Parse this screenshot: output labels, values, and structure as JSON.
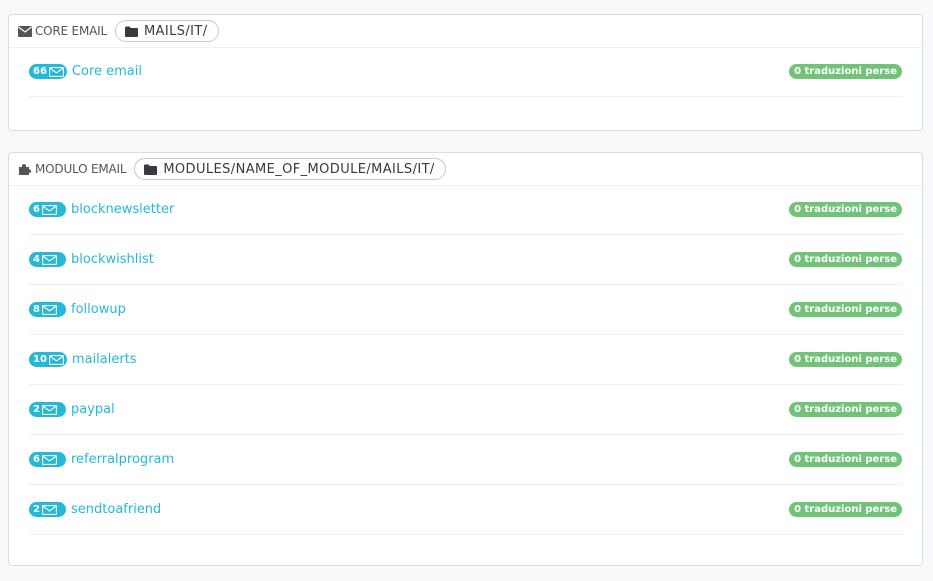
{
  "core_section": {
    "title": "CORE EMAIL",
    "path": "MAILS/IT/",
    "rows": [
      {
        "count": "66",
        "label": "Core email",
        "status": "0 traduzioni perse"
      }
    ]
  },
  "module_section": {
    "title": "MODULO EMAIL",
    "path": "MODULES/NAME_OF_MODULE/MAILS/IT/",
    "rows": [
      {
        "count": "6",
        "label": "blocknewsletter",
        "status": "0 traduzioni perse"
      },
      {
        "count": "4",
        "label": "blockwishlist",
        "status": "0 traduzioni perse"
      },
      {
        "count": "8",
        "label": "followup",
        "status": "0 traduzioni perse"
      },
      {
        "count": "10",
        "label": "mailalerts",
        "status": "0 traduzioni perse"
      },
      {
        "count": "2",
        "label": "paypal",
        "status": "0 traduzioni perse"
      },
      {
        "count": "6",
        "label": "referralprogram",
        "status": "0 traduzioni perse"
      },
      {
        "count": "2",
        "label": "sendtoafriend",
        "status": "0 traduzioni perse"
      }
    ]
  },
  "icons": {
    "core_header": "envelope-icon",
    "module_header": "puzzle-icon",
    "path": "folder-icon",
    "row": "envelope-outline-icon"
  },
  "colors": {
    "accent": "#25b9d7",
    "success": "#72c279",
    "border": "#d5dde6"
  }
}
